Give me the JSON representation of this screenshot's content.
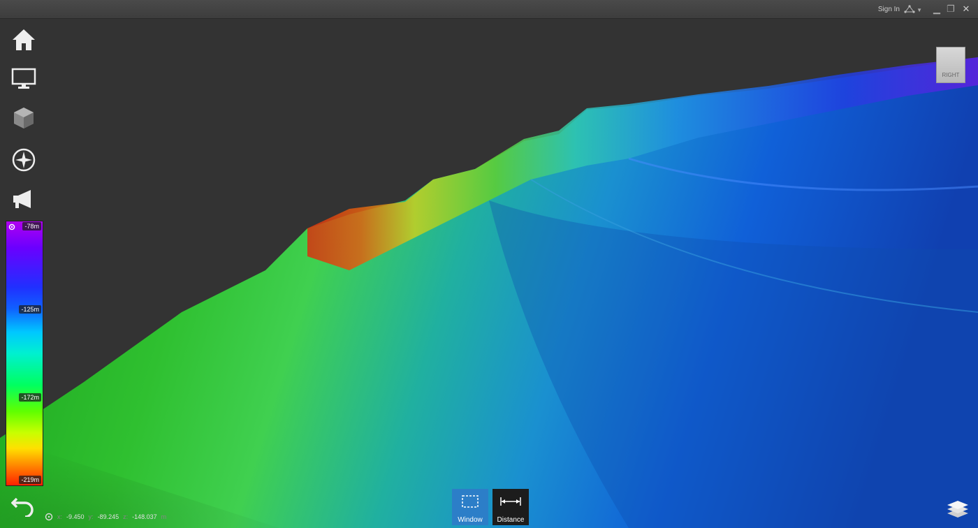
{
  "titlebar": {
    "sign_in": "Sign In",
    "icons": [
      "network-icon",
      "dropdown-arrow-icon",
      "minimize-icon",
      "restore-icon",
      "close-icon"
    ]
  },
  "sidebar": {
    "icons": [
      "home-icon",
      "monitor-icon",
      "cube-icon",
      "compass-icon",
      "megaphone-icon"
    ]
  },
  "colorbar": {
    "icon": "gear-icon",
    "labels": [
      "-78m",
      "-125m",
      "-172m",
      "-219m"
    ]
  },
  "coords": {
    "icon": "target-icon",
    "x_label": "x:",
    "x": "-9.450",
    "y_label": "y:",
    "y": "-89.245",
    "z_label": "z:",
    "z": "-148.037",
    "unit": "m"
  },
  "tools": {
    "window": {
      "label": "Window",
      "icon": "selection-rectangle-icon"
    },
    "distance": {
      "label": "Distance",
      "icon": "measure-distance-icon"
    }
  },
  "navcube": {
    "face_label": "RIGHT"
  },
  "bottom_left_icon": "undo-icon",
  "bottom_right_icon": "layers-icon"
}
